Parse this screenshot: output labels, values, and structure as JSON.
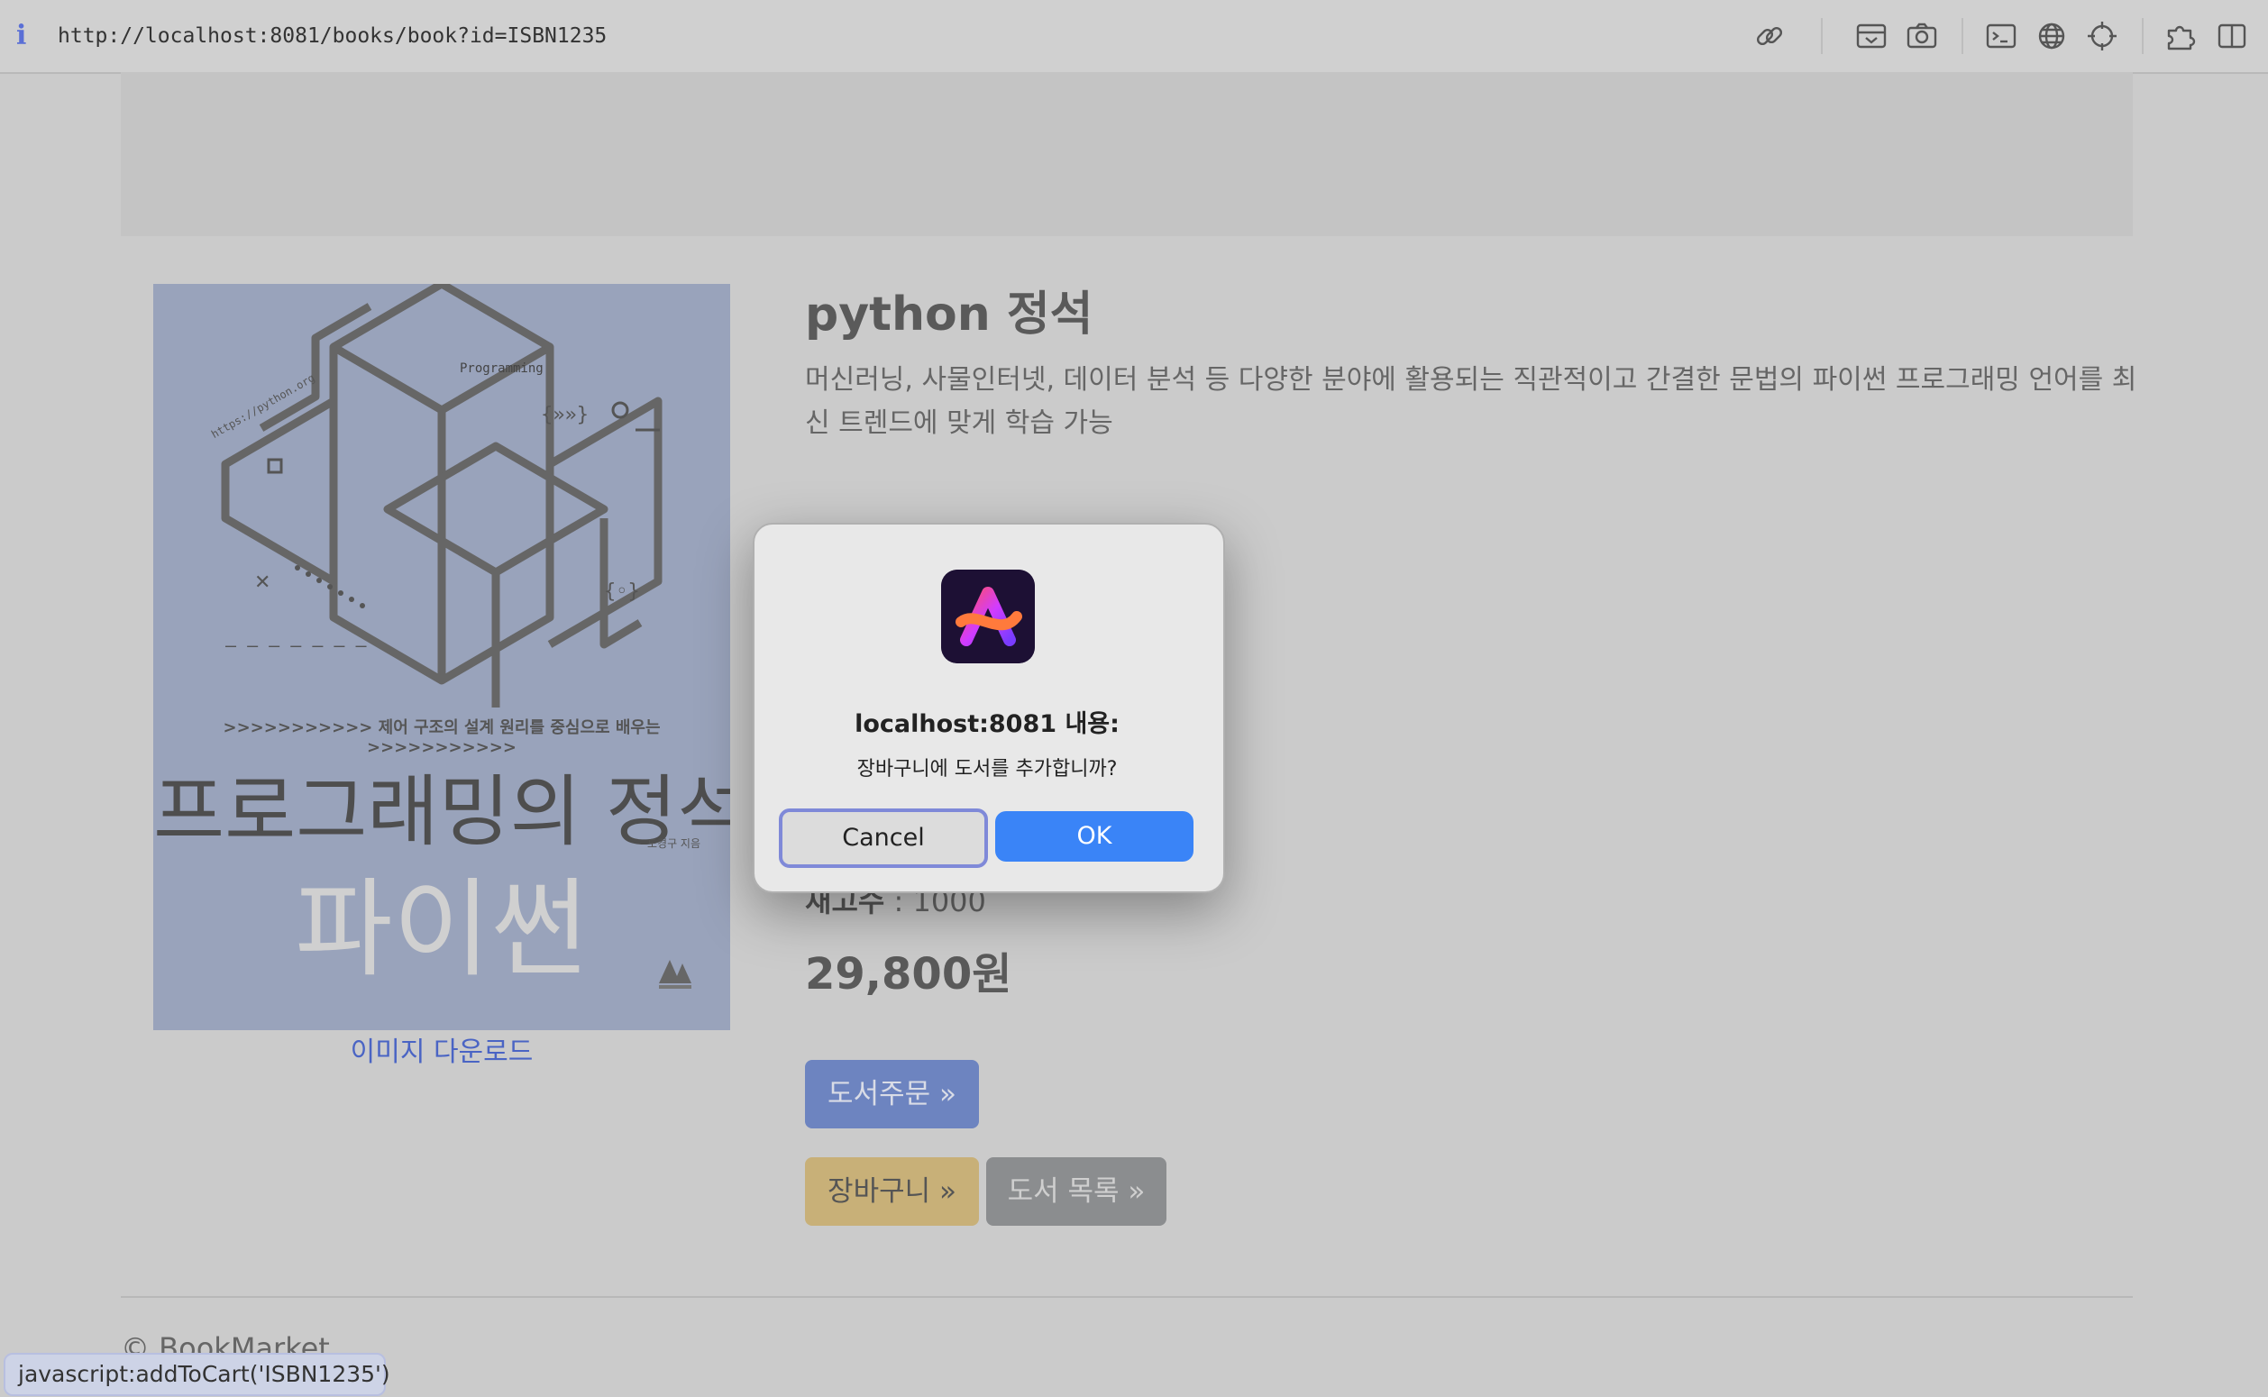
{
  "browser": {
    "url": "http://localhost:8081/books/book?id=ISBN1235",
    "info_icon": "i",
    "toolbar_icons": [
      "link-icon",
      "screenshot-box-icon",
      "camera-icon",
      "terminal-icon",
      "globe-icon",
      "crosshair-icon",
      "extensions-icon",
      "sidebar-icon"
    ]
  },
  "book": {
    "cover": {
      "banner": ">>>>>>>>>>> 제어 구조의 설계 원리를 중심으로 배우는 >>>>>>>>>>>",
      "title_line1": "프로그래밍의 정석",
      "title_line2": "파이썬",
      "author": "도경구 지음",
      "programming_label": "Programming",
      "url_text": "https://python.org"
    },
    "image_download": "이미지 다운로드",
    "title": "python 정석",
    "description": "머신러닝, 사물인터넷, 데이터 분석 등 다양한 분야에 활용되는 직관적이고 간결한 문법의 파이썬 프로그래밍 언어를 최신 트렌드에 맞게 학습 가능",
    "stock_label": "재고수",
    "stock_value": " : 1000",
    "price": "29,800원",
    "order_button": "도서주문 »",
    "cart_button": "장바구니 »",
    "list_button": "도서 목록 »"
  },
  "footer": {
    "text": "© BookMarket"
  },
  "status_bar": {
    "text": "javascript:addToCart('ISBN1235')"
  },
  "dialog": {
    "title": "localhost:8081 내용:",
    "message": "장바구니에 도서를 추가합니까?",
    "cancel": "Cancel",
    "ok": "OK"
  },
  "colors": {
    "ok_button": "#3a84f7",
    "cancel_focus_ring": "#7f89d8",
    "order_button": "#6d84c0",
    "cart_button": "#c8b078",
    "list_button": "#8b8d8f"
  }
}
